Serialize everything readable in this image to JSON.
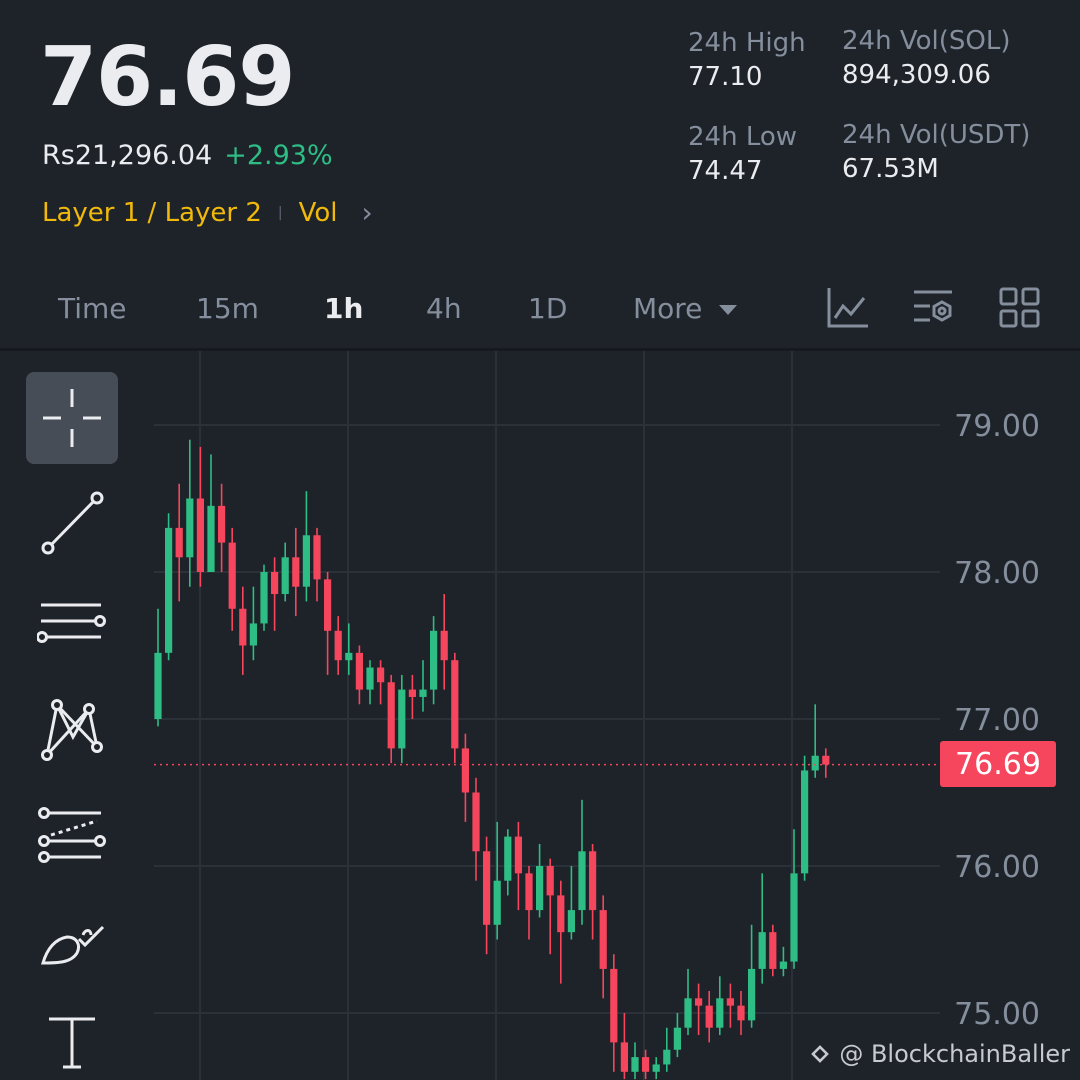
{
  "header": {
    "last_price": "76.69",
    "fiat_price": "Rs21,296.04",
    "change_pct": "+2.93%",
    "tag_primary": "Layer 1 / Layer 2",
    "tag_secondary": "Vol"
  },
  "stats": {
    "high_label": "24h High",
    "high_value": "77.10",
    "low_label": "24h Low",
    "low_value": "74.47",
    "vol_base_label": "24h Vol(SOL)",
    "vol_base_value": "894,309.06",
    "vol_quote_label": "24h Vol(USDT)",
    "vol_quote_value": "67.53M"
  },
  "tabs": [
    {
      "label": "Time"
    },
    {
      "label": "15m"
    },
    {
      "label": "1h",
      "active": true
    },
    {
      "label": "4h"
    },
    {
      "label": "1D"
    },
    {
      "label": "More"
    }
  ],
  "toolbar_icons": [
    "indicator-icon",
    "settings-icon",
    "layout-grid-icon"
  ],
  "drawing_tools": [
    "crosshair-icon",
    "trend-line-icon",
    "horizontal-lines-icon",
    "pattern-icon",
    "parallel-channel-icon",
    "brush-icon",
    "text-icon"
  ],
  "colors": {
    "up": "#2ebd85",
    "down": "#f6465d",
    "accent": "#f0b90b",
    "bg": "#1e2329"
  },
  "chart_data": {
    "type": "candlestick",
    "y_ticks": [
      "79.00",
      "78.00",
      "77.00",
      "76.00",
      "75.00"
    ],
    "ylim": [
      74.55,
      79.05
    ],
    "current_price": 76.69,
    "current_price_label": "76.69",
    "candles": [
      [
        77.0,
        77.45,
        77.75,
        76.95
      ],
      [
        77.45,
        78.3,
        78.4,
        77.4
      ],
      [
        78.3,
        78.1,
        78.6,
        77.8
      ],
      [
        78.1,
        78.5,
        78.9,
        77.9
      ],
      [
        78.5,
        78.0,
        78.85,
        77.9
      ],
      [
        78.0,
        78.45,
        78.8,
        78.0
      ],
      [
        78.45,
        78.2,
        78.6,
        78.0
      ],
      [
        78.2,
        77.75,
        78.3,
        77.6
      ],
      [
        77.75,
        77.5,
        77.9,
        77.3
      ],
      [
        77.5,
        77.65,
        77.9,
        77.4
      ],
      [
        77.65,
        78.0,
        78.05,
        77.6
      ],
      [
        78.0,
        77.85,
        78.1,
        77.6
      ],
      [
        77.85,
        78.1,
        78.2,
        77.8
      ],
      [
        78.1,
        77.9,
        78.3,
        77.7
      ],
      [
        77.9,
        78.25,
        78.55,
        77.8
      ],
      [
        78.25,
        77.95,
        78.3,
        77.8
      ],
      [
        77.95,
        77.6,
        78.0,
        77.3
      ],
      [
        77.6,
        77.4,
        77.7,
        77.3
      ],
      [
        77.4,
        77.45,
        77.65,
        77.3
      ],
      [
        77.45,
        77.2,
        77.5,
        77.1
      ],
      [
        77.2,
        77.35,
        77.4,
        77.1
      ],
      [
        77.35,
        77.25,
        77.4,
        77.1
      ],
      [
        77.25,
        76.8,
        77.3,
        76.7
      ],
      [
        76.8,
        77.2,
        77.3,
        76.7
      ],
      [
        77.2,
        77.15,
        77.3,
        77.0
      ],
      [
        77.15,
        77.2,
        77.4,
        77.05
      ],
      [
        77.2,
        77.6,
        77.7,
        77.1
      ],
      [
        77.6,
        77.4,
        77.85,
        77.2
      ],
      [
        77.4,
        76.8,
        77.45,
        76.7
      ],
      [
        76.8,
        76.5,
        76.9,
        76.3
      ],
      [
        76.5,
        76.1,
        76.6,
        75.9
      ],
      [
        76.1,
        75.6,
        76.2,
        75.4
      ],
      [
        75.6,
        75.9,
        76.3,
        75.5
      ],
      [
        75.9,
        76.2,
        76.25,
        75.8
      ],
      [
        76.2,
        75.95,
        76.3,
        75.7
      ],
      [
        75.95,
        75.7,
        76.0,
        75.5
      ],
      [
        75.7,
        76.0,
        76.15,
        75.65
      ],
      [
        76.0,
        75.8,
        76.05,
        75.4
      ],
      [
        75.8,
        75.55,
        75.9,
        75.2
      ],
      [
        75.55,
        75.7,
        76.0,
        75.5
      ],
      [
        75.7,
        76.1,
        76.45,
        75.6
      ],
      [
        76.1,
        75.7,
        76.15,
        75.5
      ],
      [
        75.7,
        75.3,
        75.8,
        75.1
      ],
      [
        75.3,
        74.8,
        75.4,
        74.6
      ],
      [
        74.8,
        74.6,
        75.0,
        74.55
      ],
      [
        74.6,
        74.7,
        74.8,
        74.55
      ],
      [
        74.7,
        74.6,
        74.75,
        74.55
      ],
      [
        74.6,
        74.65,
        74.7,
        74.55
      ],
      [
        74.65,
        74.75,
        74.9,
        74.6
      ],
      [
        74.75,
        74.9,
        75.0,
        74.7
      ],
      [
        74.9,
        75.1,
        75.3,
        74.85
      ],
      [
        75.1,
        75.05,
        75.2,
        74.85
      ],
      [
        75.05,
        74.9,
        75.15,
        74.8
      ],
      [
        74.9,
        75.1,
        75.25,
        74.85
      ],
      [
        75.1,
        75.05,
        75.2,
        74.9
      ],
      [
        75.05,
        74.95,
        75.15,
        74.85
      ],
      [
        74.95,
        75.3,
        75.6,
        74.9
      ],
      [
        75.3,
        75.55,
        75.95,
        75.2
      ],
      [
        75.55,
        75.3,
        75.6,
        75.25
      ],
      [
        75.3,
        75.35,
        75.45,
        75.25
      ],
      [
        75.35,
        75.95,
        76.25,
        75.3
      ],
      [
        75.95,
        76.65,
        76.75,
        75.9
      ],
      [
        76.65,
        76.75,
        77.1,
        76.6
      ],
      [
        76.75,
        76.69,
        76.8,
        76.6
      ]
    ]
  },
  "watermark": "@ BlockchainBaller"
}
